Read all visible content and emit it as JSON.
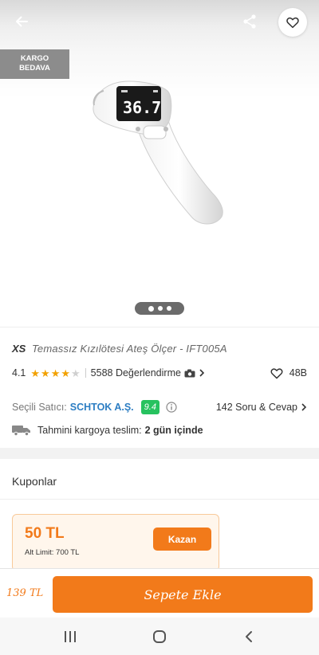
{
  "header": {
    "back_icon": "arrow-left-icon",
    "share_icon": "share-icon",
    "favorite_icon": "heart-outline-icon"
  },
  "hero": {
    "badge_line1": "KARGO",
    "badge_line2": "BEDAVA",
    "product_display_reading": "36.7",
    "carousel": {
      "pages": 3,
      "active": 1
    }
  },
  "product": {
    "brand": "XS",
    "name": "Temassız Kızılötesi Ateş Ölçer - IFT005A",
    "rating": "4.1",
    "stars_full": 4,
    "stars_total": 5,
    "reviews_label": "5588 Değerlendirme",
    "favorites_count": "48B"
  },
  "seller": {
    "label": "Seçili Satıcı:",
    "name": "SCHTOK A.Ş.",
    "score": "9.4",
    "qa_label": "142 Soru & Cevap"
  },
  "delivery": {
    "label": "Tahmini kargoya teslim:",
    "value": "2 gün içinde"
  },
  "coupons": {
    "title": "Kuponlar",
    "items": [
      {
        "amount": "50 TL",
        "limit": "Alt Limit: 700 TL",
        "button": "Kazan"
      }
    ]
  },
  "bottom_bar": {
    "price": "139 TL",
    "add_to_cart": "Sepete Ekle"
  },
  "colors": {
    "accent": "#f27a1a",
    "seller_link": "#2d7ec3",
    "score_badge": "#27c25f",
    "star": "#f2a100"
  }
}
